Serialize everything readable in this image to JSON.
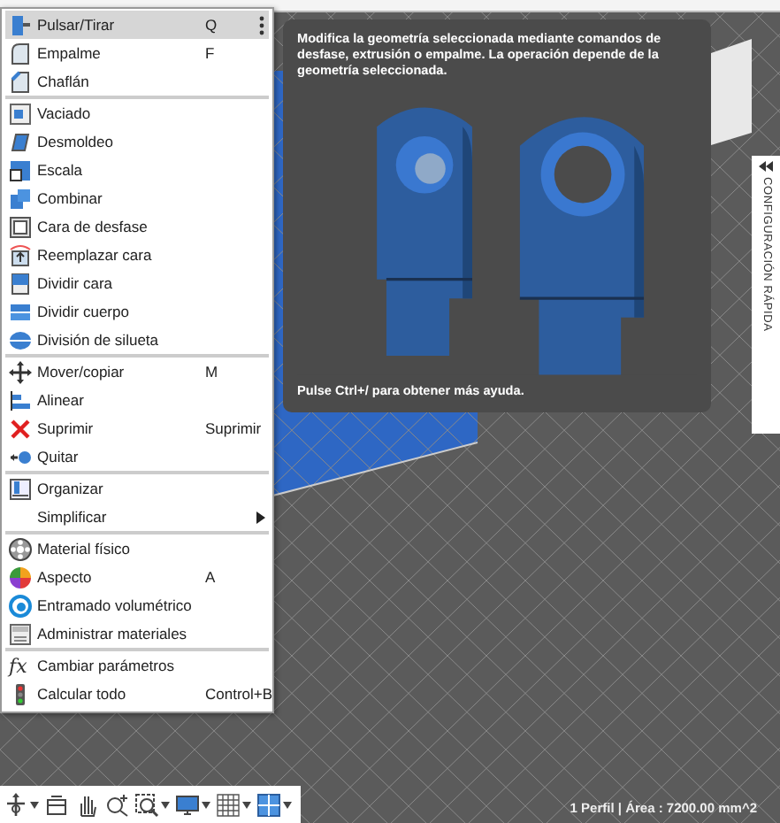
{
  "menu": {
    "sections": [
      [
        {
          "label": "Pulsar/Tirar",
          "shortcut": "Q",
          "selected": true,
          "options": true
        },
        {
          "label": "Empalme",
          "shortcut": "F",
          "selected": false
        },
        {
          "label": "Chaflán",
          "selected": false
        }
      ],
      [
        {
          "label": "Vaciado",
          "selected": false
        },
        {
          "label": "Desmoldeo",
          "selected": false
        },
        {
          "label": "Escala",
          "selected": false
        },
        {
          "label": "Combinar",
          "selected": false
        },
        {
          "label": "Cara de desfase",
          "selected": false
        },
        {
          "label": "Reemplazar cara",
          "selected": false
        },
        {
          "label": "Dividir cara",
          "selected": false
        },
        {
          "label": "Dividir cuerpo",
          "selected": false
        },
        {
          "label": "División de silueta",
          "selected": false
        }
      ],
      [
        {
          "label": "Mover/copiar",
          "shortcut": "M",
          "selected": false
        },
        {
          "label": "Alinear",
          "selected": false
        },
        {
          "label": "Suprimir",
          "shortcut": "Suprimir",
          "selected": false
        },
        {
          "label": "Quitar",
          "selected": false
        }
      ],
      [
        {
          "label": "Organizar",
          "selected": false
        },
        {
          "label": "Simplificar",
          "selected": false,
          "submenu": true
        }
      ],
      [
        {
          "label": "Material físico",
          "selected": false
        },
        {
          "label": "Aspecto",
          "shortcut": "A",
          "selected": false
        },
        {
          "label": "Entramado volumétrico",
          "selected": false
        },
        {
          "label": "Administrar materiales",
          "selected": false
        }
      ],
      [
        {
          "label": "Cambiar parámetros",
          "icon_text": "fx",
          "selected": false
        },
        {
          "label": "Calcular todo",
          "shortcut": "Control+B",
          "selected": false
        }
      ]
    ]
  },
  "tooltip": {
    "description": "Modifica la geometría seleccionada mediante comandos de desfase, extrusión o empalme. La operación depende de la geometría seleccionada.",
    "footer": "Pulse Ctrl+/ para obtener más ayuda."
  },
  "side_panel": {
    "title": "CONFIGURACIÓN RÁPIDA"
  },
  "status_bar": {
    "text": "1 Perfil | Área : 7200.00 mm^2"
  }
}
